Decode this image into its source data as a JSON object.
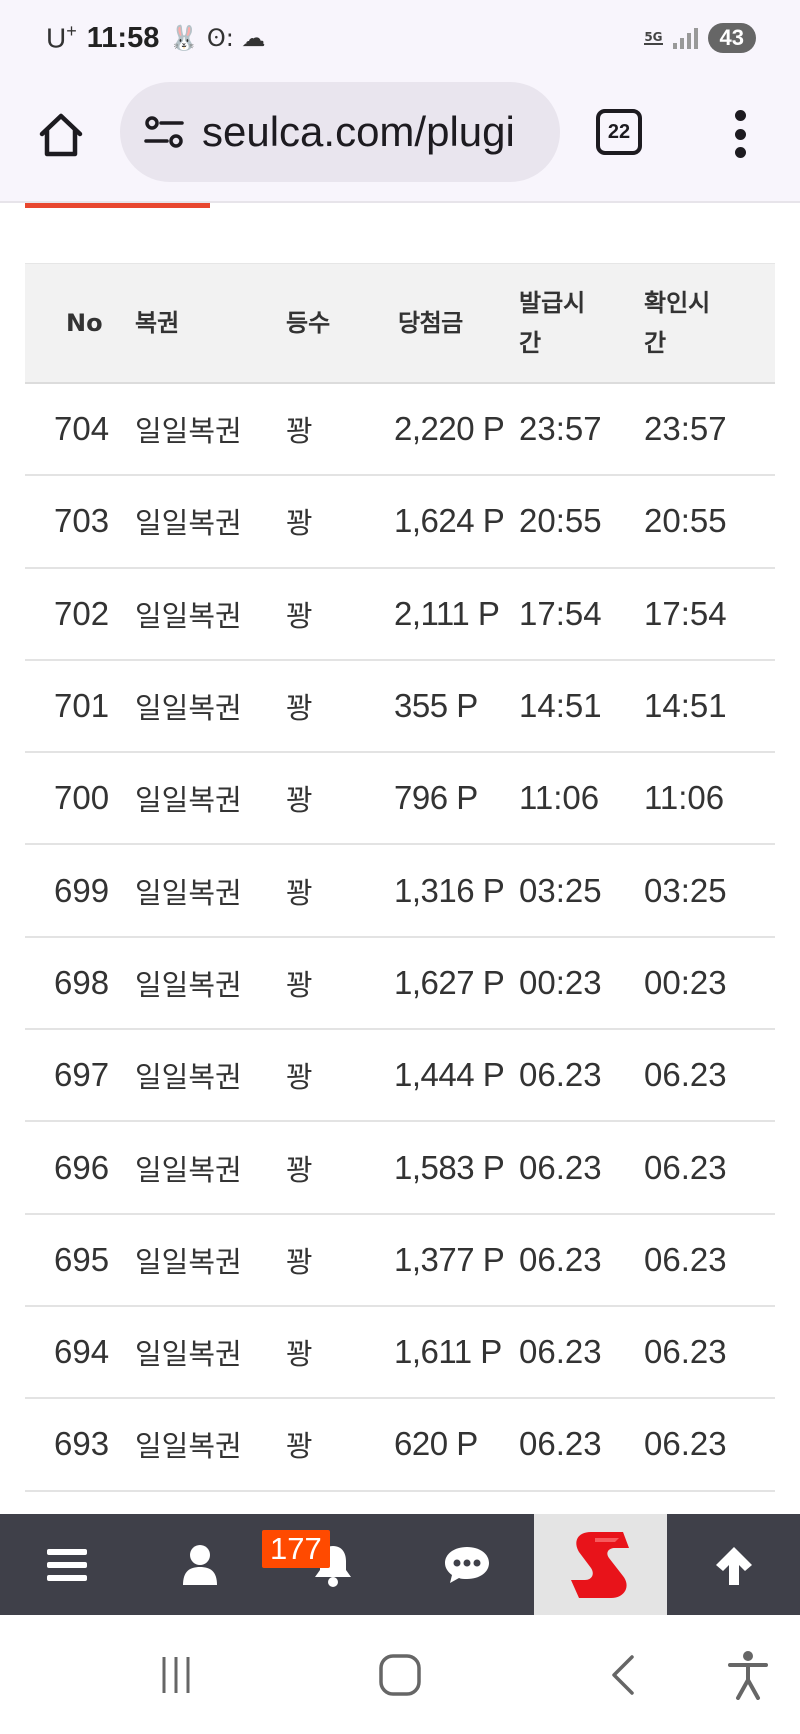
{
  "status_bar": {
    "carrier": "U",
    "carrier_sup": "+",
    "time": "11:58",
    "indicator_glyphs": "🐰 ʘ: ☁",
    "network_label": "5G",
    "battery": "43"
  },
  "browser": {
    "url": "seulca.com/plugi",
    "tab_count": "22"
  },
  "table": {
    "headers": {
      "no": "No",
      "lottery": "복권",
      "rank": "등수",
      "prize": "당첨금",
      "issued_line1": "발급시",
      "issued_line2": "간",
      "checked_line1": "확인시",
      "checked_line2": "간"
    },
    "rows": [
      {
        "no": "704",
        "lottery": "일일복권",
        "rank": "꽝",
        "prize": "2,220 P",
        "issued": "23:57",
        "checked": "23:57"
      },
      {
        "no": "703",
        "lottery": "일일복권",
        "rank": "꽝",
        "prize": "1,624 P",
        "issued": "20:55",
        "checked": "20:55"
      },
      {
        "no": "702",
        "lottery": "일일복권",
        "rank": "꽝",
        "prize": "2,111 P",
        "issued": "17:54",
        "checked": "17:54"
      },
      {
        "no": "701",
        "lottery": "일일복권",
        "rank": "꽝",
        "prize": "355 P",
        "issued": "14:51",
        "checked": "14:51"
      },
      {
        "no": "700",
        "lottery": "일일복권",
        "rank": "꽝",
        "prize": "796 P",
        "issued": "11:06",
        "checked": "11:06"
      },
      {
        "no": "699",
        "lottery": "일일복권",
        "rank": "꽝",
        "prize": "1,316 P",
        "issued": "03:25",
        "checked": "03:25"
      },
      {
        "no": "698",
        "lottery": "일일복권",
        "rank": "꽝",
        "prize": "1,627 P",
        "issued": "00:23",
        "checked": "00:23"
      },
      {
        "no": "697",
        "lottery": "일일복권",
        "rank": "꽝",
        "prize": "1,444 P",
        "issued": "06.23",
        "checked": "06.23"
      },
      {
        "no": "696",
        "lottery": "일일복권",
        "rank": "꽝",
        "prize": "1,583 P",
        "issued": "06.23",
        "checked": "06.23"
      },
      {
        "no": "695",
        "lottery": "일일복권",
        "rank": "꽝",
        "prize": "1,377 P",
        "issued": "06.23",
        "checked": "06.23"
      },
      {
        "no": "694",
        "lottery": "일일복권",
        "rank": "꽝",
        "prize": "1,611 P",
        "issued": "06.23",
        "checked": "06.23"
      },
      {
        "no": "693",
        "lottery": "일일복권",
        "rank": "꽝",
        "prize": "620 P",
        "issued": "06.23",
        "checked": "06.23"
      }
    ]
  },
  "bottom_bar": {
    "notification_count": "177",
    "icons": [
      "menu-icon",
      "user-icon",
      "bell-icon",
      "chat-icon",
      "site-logo",
      "arrow-up-icon"
    ]
  },
  "colors": {
    "accent": "#e8472f",
    "bottom_bar_bg": "#3f4049",
    "badge_bg": "#ff4a00",
    "browser_bg": "#f8f5fc",
    "logo_red": "#e8131a"
  }
}
